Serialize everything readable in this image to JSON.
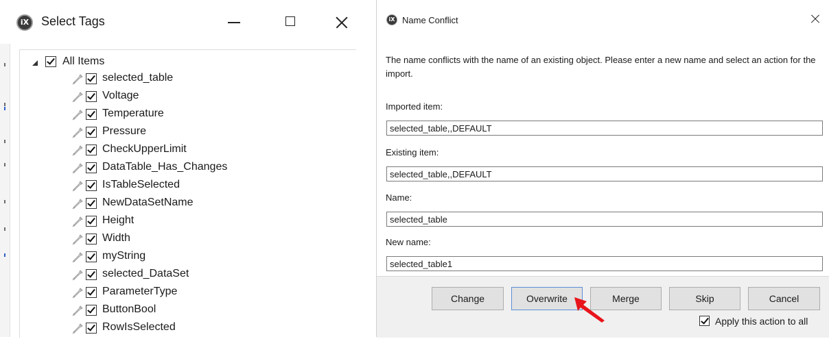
{
  "select_tags_window": {
    "logo_text": "iX",
    "title": "Select Tags",
    "root_item": {
      "label": "All Items",
      "checked": true
    },
    "tags": [
      {
        "label": "selected_table",
        "checked": true
      },
      {
        "label": "Voltage",
        "checked": true
      },
      {
        "label": "Temperature",
        "checked": true
      },
      {
        "label": "Pressure",
        "checked": true
      },
      {
        "label": "CheckUpperLimit",
        "checked": true
      },
      {
        "label": "DataTable_Has_Changes",
        "checked": true
      },
      {
        "label": "IsTableSelected",
        "checked": true
      },
      {
        "label": "NewDataSetName",
        "checked": true
      },
      {
        "label": "Height",
        "checked": true
      },
      {
        "label": "Width",
        "checked": true
      },
      {
        "label": "myString",
        "checked": true
      },
      {
        "label": "selected_DataSet",
        "checked": true
      },
      {
        "label": "ParameterType",
        "checked": true
      },
      {
        "label": "ButtonBool",
        "checked": true
      },
      {
        "label": "RowIsSelected",
        "checked": true
      }
    ]
  },
  "name_conflict_dialog": {
    "logo_text": "iX",
    "title": "Name Conflict",
    "message": "The name conflicts with the name of an existing object. Please enter a new name and select an action for the import.",
    "imported_item": {
      "label": "Imported item:",
      "value": "selected_table,,DEFAULT"
    },
    "existing_item": {
      "label": "Existing item:",
      "value": "selected_table,,DEFAULT"
    },
    "name": {
      "label": "Name:",
      "value": "selected_table"
    },
    "new_name": {
      "label": "New name:",
      "value": "selected_table1"
    },
    "buttons": {
      "change": "Change",
      "overwrite": "Overwrite",
      "merge": "Merge",
      "skip": "Skip",
      "cancel": "Cancel"
    },
    "apply_to_all": {
      "label": "Apply this action to all",
      "checked": true
    }
  },
  "colors": {
    "annotation_arrow": "#e8141b",
    "button_face": "#e1e1e1",
    "button_bar": "#f0f0f0"
  }
}
